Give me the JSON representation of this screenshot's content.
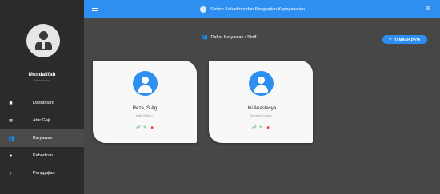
{
  "sidebar": {
    "user_name": "Musdalifah",
    "user_role": "Administrator",
    "items": [
      {
        "label": "Dashboard",
        "icon": "dashboard-icon"
      },
      {
        "label": "Atur Gaji",
        "icon": "money-icon"
      },
      {
        "label": "Karyawan",
        "icon": "people-icon",
        "active": true
      },
      {
        "label": "Kehadiran",
        "icon": "attendance-icon"
      },
      {
        "label": "Penggajian",
        "icon": "payroll-icon"
      }
    ]
  },
  "topbar": {
    "title": "Sistem Kehadiran dan Penggajian Kepegawaian",
    "accent": "#2e8ff0"
  },
  "main": {
    "section_title": "Daftar Karyawan / Staff",
    "add_button": "TAMBAH DATA",
    "employees": [
      {
        "name": "Reza, S.Ag",
        "role": "Wakil Rektor 1"
      },
      {
        "name": "Uni Anastasya",
        "role": "Sekretaris Utama"
      }
    ]
  },
  "colors": {
    "accent": "#2e8ff0",
    "sidebar": "#2b2b2b",
    "content": "#474747",
    "edit": "#35b14a",
    "delete": "#e53935"
  }
}
